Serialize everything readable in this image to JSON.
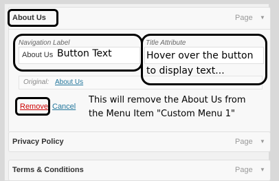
{
  "menu_items": [
    {
      "title": "About Us",
      "type": "Page"
    },
    {
      "title": "Privacy Policy",
      "type": "Page"
    },
    {
      "title": "Terms & Conditions",
      "type": "Page"
    }
  ],
  "settings": {
    "nav_label_label": "Navigation Label",
    "nav_label_value": "About Us",
    "title_attr_label": "Title Attribute",
    "original_label": "Original:",
    "original_link": "About Us",
    "remove_label": "Remove",
    "cancel_label": "Cancel"
  },
  "annotations": {
    "button_text": "Button Text",
    "hover_line1": "Hover over the button",
    "hover_line2": "to display text...",
    "remove_line1": "This will remove the About Us from",
    "remove_line2": "the Menu Item \"Custom Menu 1\""
  },
  "colors": {
    "remove": "#cc0000",
    "link": "#21759b"
  }
}
